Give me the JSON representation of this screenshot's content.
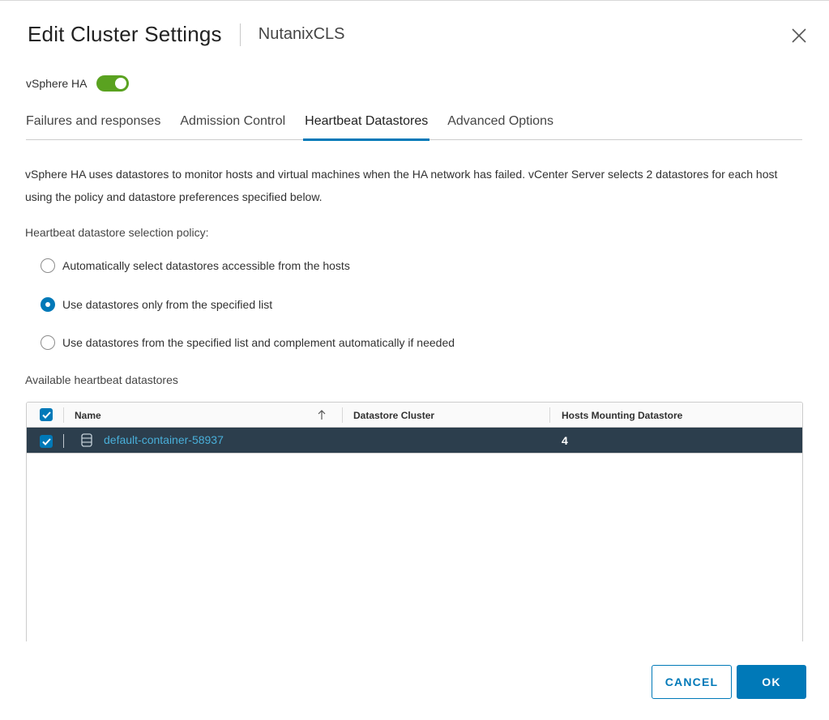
{
  "dialog": {
    "title": "Edit Cluster Settings",
    "subtitle": "NutanixCLS"
  },
  "ha": {
    "label": "vSphere HA",
    "enabled": true
  },
  "tabs": [
    {
      "label": "Failures and responses",
      "active": false
    },
    {
      "label": "Admission Control",
      "active": false
    },
    {
      "label": "Heartbeat Datastores",
      "active": true
    },
    {
      "label": "Advanced Options",
      "active": false
    }
  ],
  "description": "vSphere HA uses datastores to monitor hosts and virtual machines when the HA network has failed. vCenter Server selects 2 datastores for each host using the policy and datastore preferences specified below.",
  "policy": {
    "label": "Heartbeat datastore selection policy:",
    "options": [
      {
        "label": "Automatically select datastores accessible from the hosts",
        "checked": false
      },
      {
        "label": "Use datastores only from the specified list",
        "checked": true
      },
      {
        "label": "Use datastores from the specified list and complement automatically if needed",
        "checked": false
      }
    ]
  },
  "available_label": "Available heartbeat datastores",
  "grid": {
    "columns": [
      "Name",
      "Datastore Cluster",
      "Hosts Mounting Datastore"
    ],
    "sort_icon": "arrow-up-icon",
    "rows": [
      {
        "name": "default-container-58937",
        "cluster": "",
        "hosts": "4",
        "selected": true
      }
    ]
  },
  "buttons": {
    "cancel": "CANCEL",
    "ok": "OK"
  },
  "colors": {
    "accent": "#0079b8",
    "toggle_on": "#5aa220",
    "selected_row": "#2c3e4d",
    "link": "#49afd9"
  }
}
